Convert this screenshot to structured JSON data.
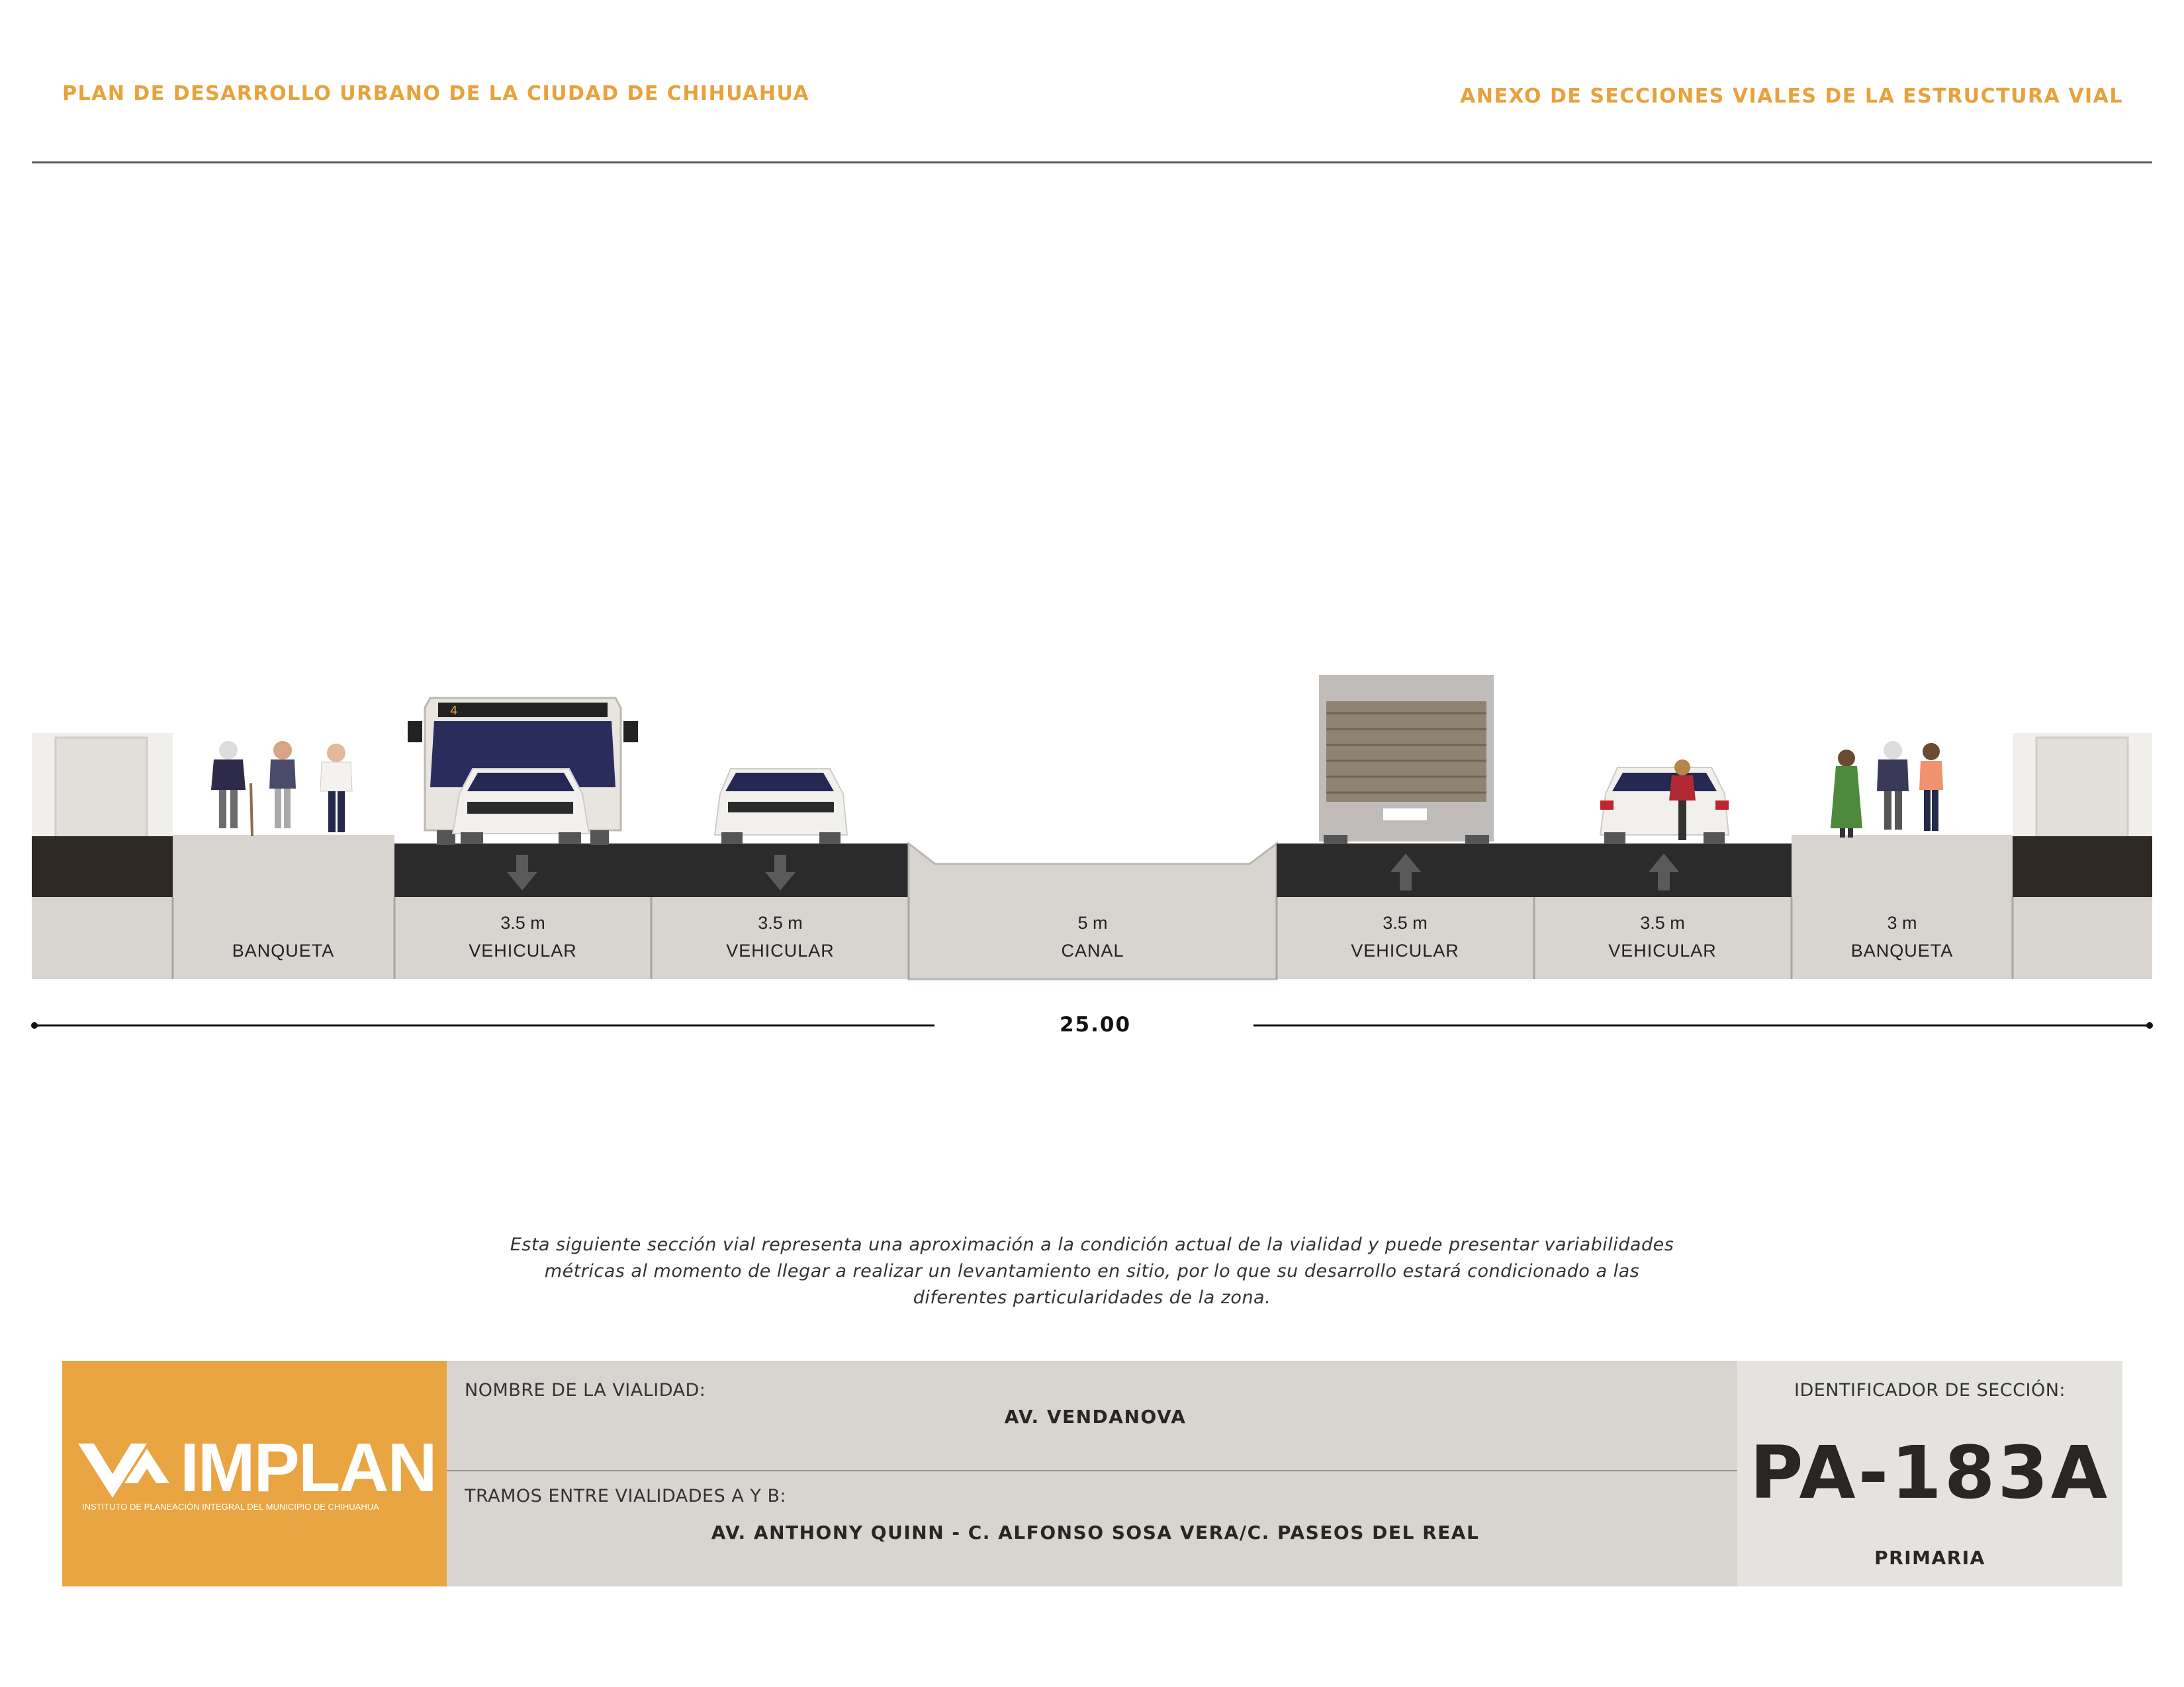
{
  "header": {
    "left_title": "PLAN DE DESARROLLO URBANO DE LA CIUDAD DE CHIHUAHUA",
    "right_title": "ANEXO DE SECCIONES VIALES DE LA ESTRUCTURA VIAL"
  },
  "section": {
    "segments": [
      {
        "width": "",
        "name": "BANQUETA"
      },
      {
        "width": "3.5 m",
        "name": "VEHICULAR",
        "direction": "down"
      },
      {
        "width": "3.5 m",
        "name": "VEHICULAR",
        "direction": "down"
      },
      {
        "width": "5 m",
        "name": "CANAL"
      },
      {
        "width": "3.5 m",
        "name": "VEHICULAR",
        "direction": "up"
      },
      {
        "width": "3.5 m",
        "name": "VEHICULAR",
        "direction": "up"
      },
      {
        "width": "3 m",
        "name": "BANQUETA"
      }
    ],
    "total_width": "25.00",
    "bus_route_number": "4",
    "colors": {
      "pavement": "#2b2b2b",
      "ground": "#d8d4cf",
      "building_base": "#2f2926",
      "accent": "#e9a542"
    }
  },
  "note": "Esta siguiente sección vial representa una aproximación a la condición actual de la vialidad y puede presentar variabilidades métricas al momento de llegar a realizar un levantamiento en sitio, por lo que su desarrollo estará condicionado a las diferentes particularidades de la zona.",
  "info_panel": {
    "logo_text": "IMPLAN",
    "logo_subtitle": "INSTITUTO DE PLANEACIÓN INTEGRAL DEL MUNICIPIO DE CHIHUAHUA",
    "road_name_label": "NOMBRE DE LA VIALIDAD:",
    "road_name": "AV. VENDANOVA",
    "segments_label": "TRAMOS ENTRE VIALIDADES A Y B:",
    "segments_value": "AV. ANTHONY QUINN - C. ALFONSO SOSA VERA/C. PASEOS DEL REAL",
    "id_label": "IDENTIFICADOR DE SECCIÓN:",
    "id_code": "PA-183A",
    "category": "PRIMARIA"
  }
}
